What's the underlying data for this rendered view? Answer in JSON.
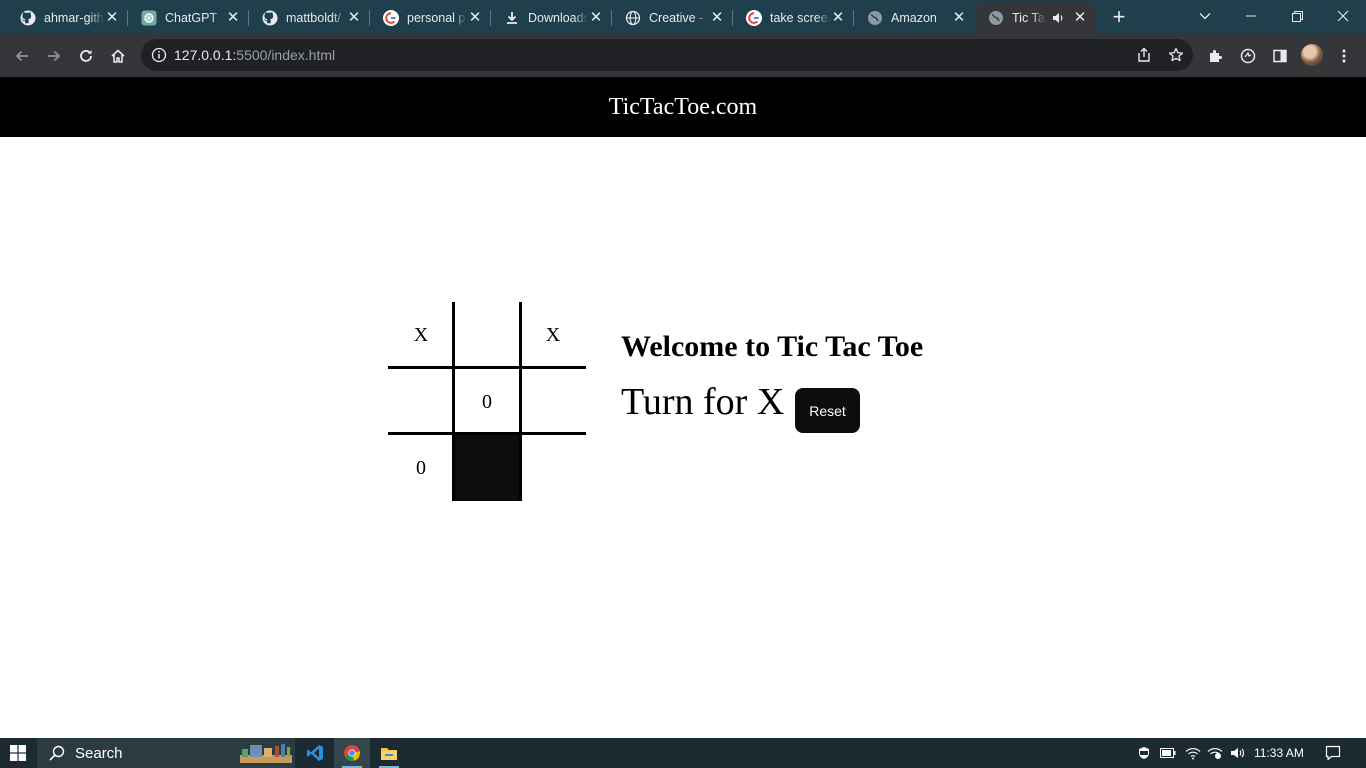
{
  "browser": {
    "tabs": [
      {
        "title": "ahmar-github",
        "icon": "github-icon"
      },
      {
        "title": "ChatGPT",
        "icon": "chatgpt-icon"
      },
      {
        "title": "mattboldt/",
        "icon": "github-icon"
      },
      {
        "title": "personal p",
        "icon": "google-icon"
      },
      {
        "title": "Downloads",
        "icon": "download-icon"
      },
      {
        "title": "Creative - S",
        "icon": "globe-icon"
      },
      {
        "title": "take screen",
        "icon": "google-icon"
      },
      {
        "title": "Amazon",
        "icon": "globe-icon"
      },
      {
        "title": "Tic Tac",
        "icon": "globe-icon",
        "active": true
      }
    ],
    "url_host": "127.0.0.1:",
    "url_path": "5500/index.html"
  },
  "page": {
    "header_title": "TicTacToe.com",
    "board": [
      "X",
      "",
      "X",
      "",
      "0",
      "",
      "0",
      "",
      ""
    ],
    "welcome": "Welcome to Tic Tac Toe",
    "turn_text": "Turn for X",
    "reset_label": "Reset"
  },
  "taskbar": {
    "search_label": "Search",
    "clock": "11:33 AM"
  },
  "colors": {
    "tabstrip": "#1f3f4d",
    "toolbar": "#35363a",
    "omnibox": "#202124",
    "site_header": "#000000",
    "reset_button": "#0d0d0d",
    "taskbar": "#1c2a31"
  }
}
